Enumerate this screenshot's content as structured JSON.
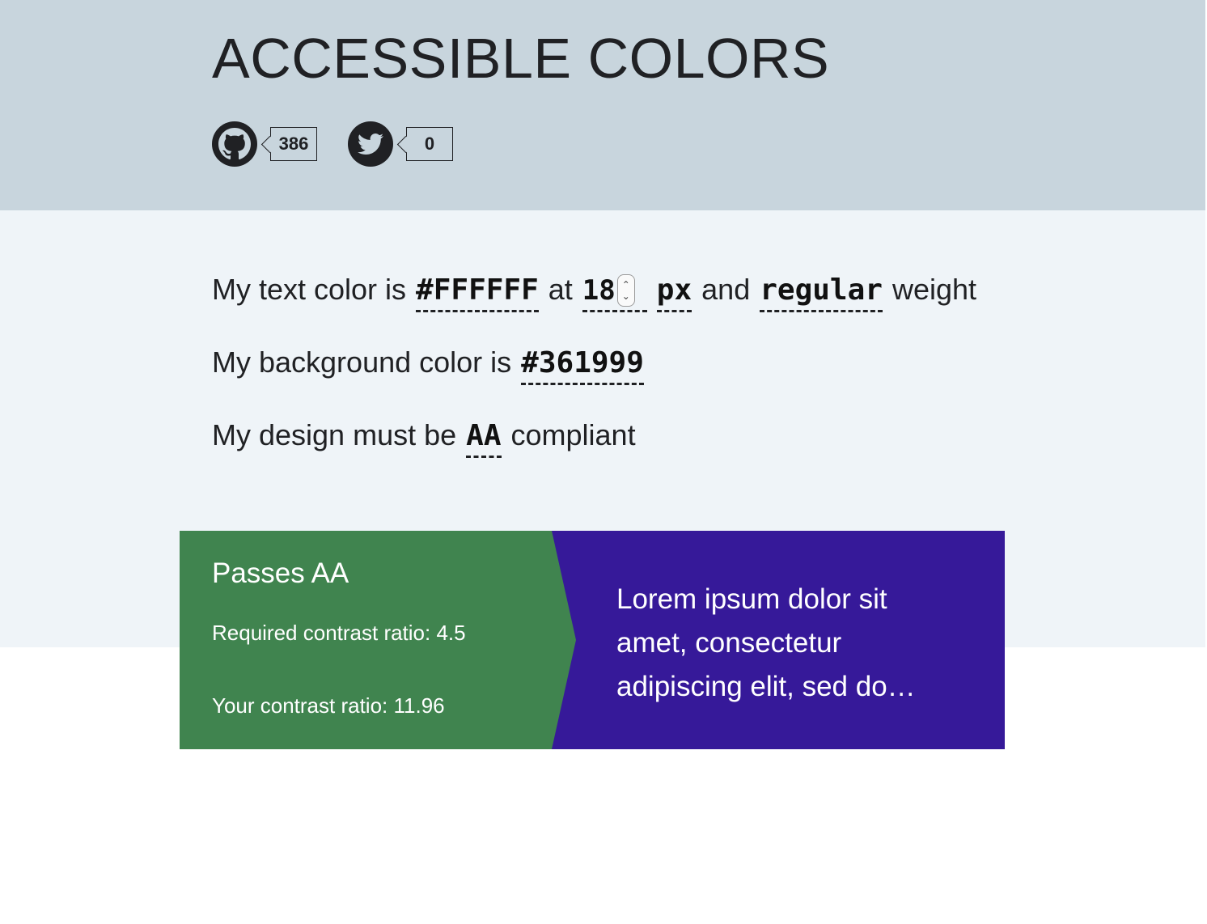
{
  "header": {
    "title": "ACCESSIBLE COLORS",
    "github": {
      "icon": "github-icon",
      "count": "386"
    },
    "twitter": {
      "icon": "twitter-icon",
      "count": "0"
    }
  },
  "config": {
    "line1": {
      "prefix": "My text color is",
      "text_color": "#FFFFFF",
      "at": "at",
      "font_size": "18",
      "unit": "px",
      "and": "and",
      "weight": "regular",
      "suffix": "weight"
    },
    "line2": {
      "prefix": "My background color is",
      "bg_color": "#361999"
    },
    "line3": {
      "prefix": "My design must be",
      "level": "AA",
      "suffix": "compliant"
    }
  },
  "result": {
    "status": "Passes AA",
    "required": "Required contrast ratio: 4.5",
    "yours": "Your contrast ratio: 11.96",
    "sample_text": "Lorem ipsum dolor sit amet, consectetur adipiscing elit, sed do…"
  },
  "colors": {
    "header_bg": "#c8d5dd",
    "config_bg": "#eff4f8",
    "pass_green": "#40844f",
    "sample_bg": "#361999",
    "sample_text": "#ffffff"
  }
}
